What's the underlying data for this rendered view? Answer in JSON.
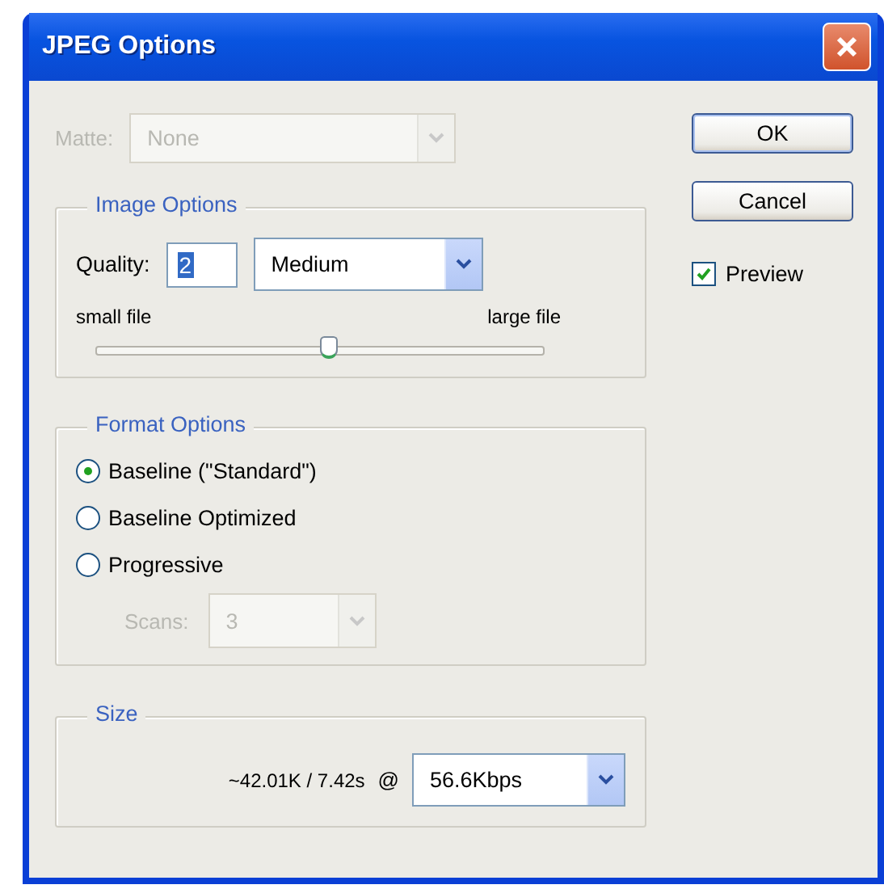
{
  "window": {
    "title": "JPEG Options"
  },
  "matte": {
    "label": "Matte:",
    "value": "None",
    "disabled": true
  },
  "image_options": {
    "title": "Image Options",
    "quality_label": "Quality:",
    "quality_value": "2",
    "preset": "Medium",
    "min_label": "small file",
    "max_label": "large file",
    "level": 0.52
  },
  "format_options": {
    "title": "Format Options",
    "choices": [
      {
        "label": "Baseline (\"Standard\")",
        "selected": true
      },
      {
        "label": "Baseline Optimized",
        "selected": false
      },
      {
        "label": "Progressive",
        "selected": false
      }
    ],
    "scans": {
      "label": "Scans:",
      "value": "3",
      "disabled": true
    }
  },
  "size": {
    "title": "Size",
    "estimate": "~42.01K / 7.42s",
    "at": "@",
    "speed": "56.6Kbps"
  },
  "buttons": [
    {
      "label": "OK",
      "default": true
    },
    {
      "label": "Cancel",
      "default": false
    }
  ],
  "preview": {
    "label": "Preview",
    "checked": true
  }
}
